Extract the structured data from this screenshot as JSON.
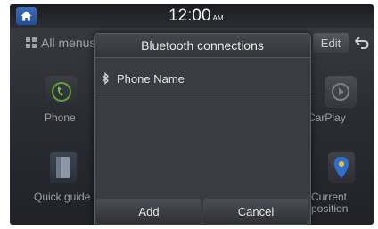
{
  "status_bar": {
    "time": "12:00",
    "ampm": "AM"
  },
  "header": {
    "all_menus_label": "All menus",
    "edit_label": "Edit"
  },
  "apps": [
    {
      "label": "Phone",
      "icon": "phone-icon"
    },
    {
      "label": "Apple CarPlay",
      "icon": "carplay-icon"
    },
    {
      "label": "Quick guide",
      "icon": "quick-guide-icon"
    },
    {
      "label": "Current position",
      "label_line1": "Current",
      "label_line2": "position",
      "icon": "location-pin-icon"
    }
  ],
  "dialog": {
    "title": "Bluetooth connections",
    "devices": [
      {
        "name": "Phone Name",
        "icon": "bluetooth-icon"
      }
    ],
    "add_label": "Add",
    "cancel_label": "Cancel"
  },
  "colors": {
    "home_button": "#2a5ca6",
    "location_icon": "#2f6fd0"
  }
}
